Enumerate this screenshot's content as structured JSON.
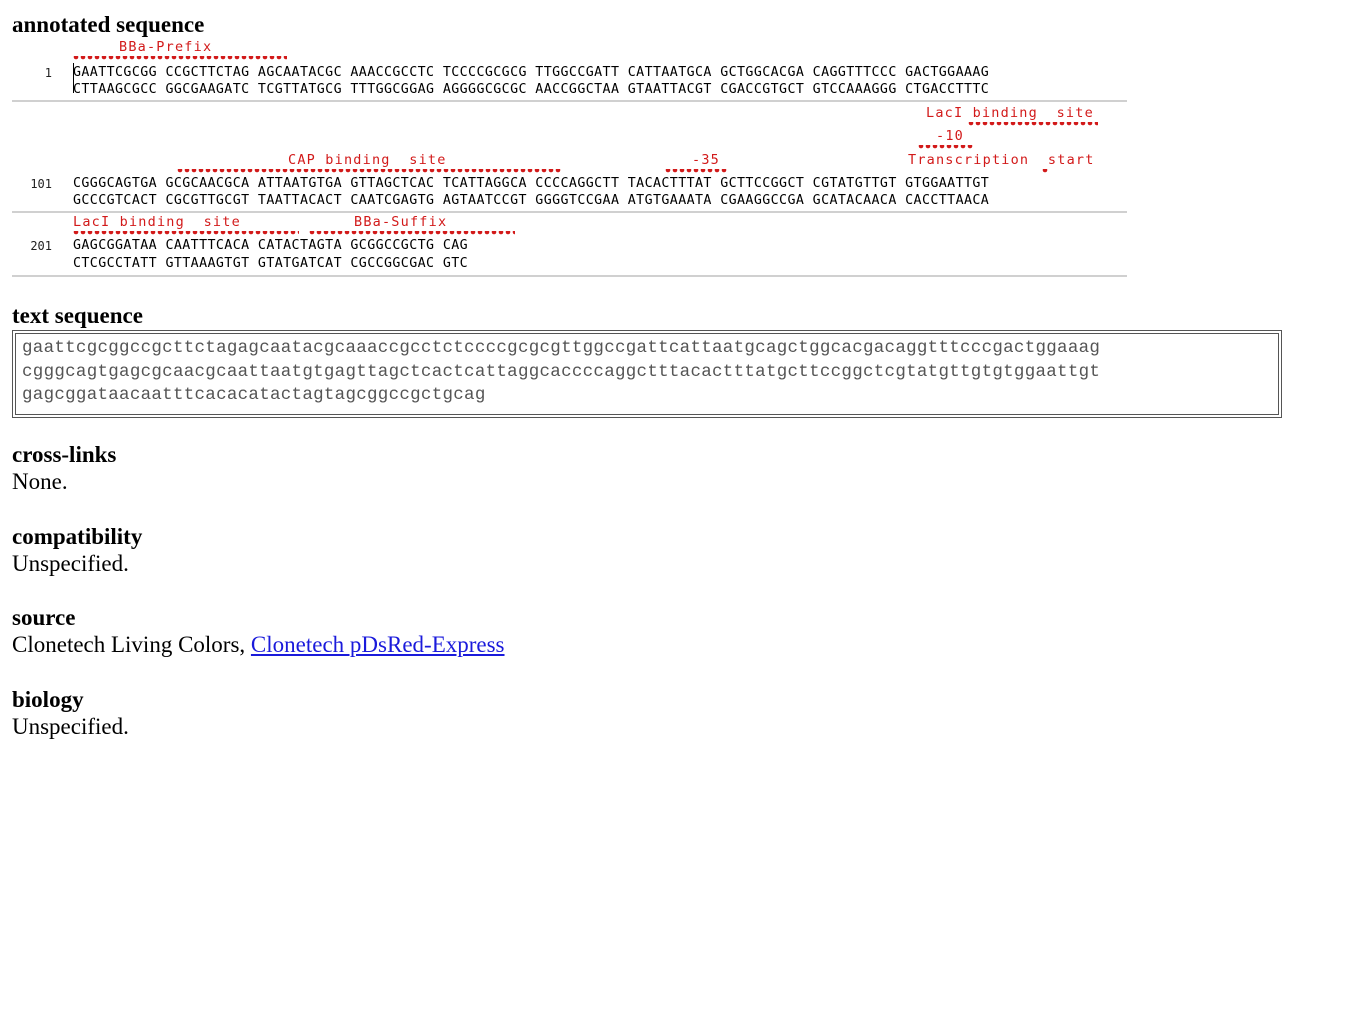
{
  "annotated_sequence": {
    "heading": "annotated sequence",
    "blocks": [
      {
        "number": "1",
        "top": "GAATTCGCGG CCGCTTCTAG AGCAATACGC AAACCGCCTC TCCCCGCGCG TTGGCCGATT CATTAATGCA GCTGGCACGA CAGGTTTCCC GACTGGAAAG",
        "bottom": "CTTAAGCGCC GGCGAAGATC TCGTTATGCG TTTGGCGGAG AGGGGCGCGC AACCGGCTAA GTAATTACGT CGACCGTGCT GTCCAAAGGG CTGACCTTTC",
        "features": [
          "BBa-Prefix"
        ]
      },
      {
        "number": "101",
        "top": "CGGGCAGTGA GCGCAACGCA ATTAATGTGA GTTAGCTCAC TCATTAGGCA CCCCAGGCTT TACACTTTAT GCTTCCGGCT CGTATGTTGT GTGGAATTGT",
        "bottom": "GCCCGTCACT CGCGTTGCGT TAATTACACT CAATCGAGTG AGTAATCCGT GGGGTCCGAA ATGTGAAATA CGAAGGCCGA GCATACAACA CACCTTAACA",
        "features": [
          "LacI binding  site",
          "-10",
          "CAP binding  site",
          "-35",
          "Transcription  start"
        ]
      },
      {
        "number": "201",
        "top": "GAGCGGATAA CAATTTCACA CATACTAGTA GCGGCCGCTG CAG",
        "bottom": "CTCGCCTATT GTTAAAGTGT GTATGATCAT CGCCGGCGAC GTC",
        "features": [
          "LacI binding  site",
          "BBa-Suffix"
        ]
      }
    ]
  },
  "text_sequence": {
    "heading": "text sequence",
    "lines": [
      "gaattcgcggccgcttctagagcaatacgcaaaccgcctctccccgcgcgttggccgattcattaatgcagctggcacgacaggtttcccgactggaaag",
      "cgggcagtgagcgcaacgcaattaatgtgagttagctcactcattaggcaccccaggctttacactttatgcttccggctcgtatgttgtgtggaattgt",
      "gagcggataacaatttcacacatactagtagcggccgctgcag"
    ]
  },
  "cross_links": {
    "heading": "cross-links",
    "value": "None."
  },
  "compatibility": {
    "heading": "compatibility",
    "value": "Unspecified."
  },
  "source": {
    "heading": "source",
    "value_prefix": "Clonetech Living Colors, ",
    "link_text": "Clonetech pDsRed-Express"
  },
  "biology": {
    "heading": "biology",
    "value": "Unspecified."
  },
  "colors": {
    "annotation": "#d21a1a",
    "link": "#1a1adb",
    "separator": "#d0d0d0"
  }
}
